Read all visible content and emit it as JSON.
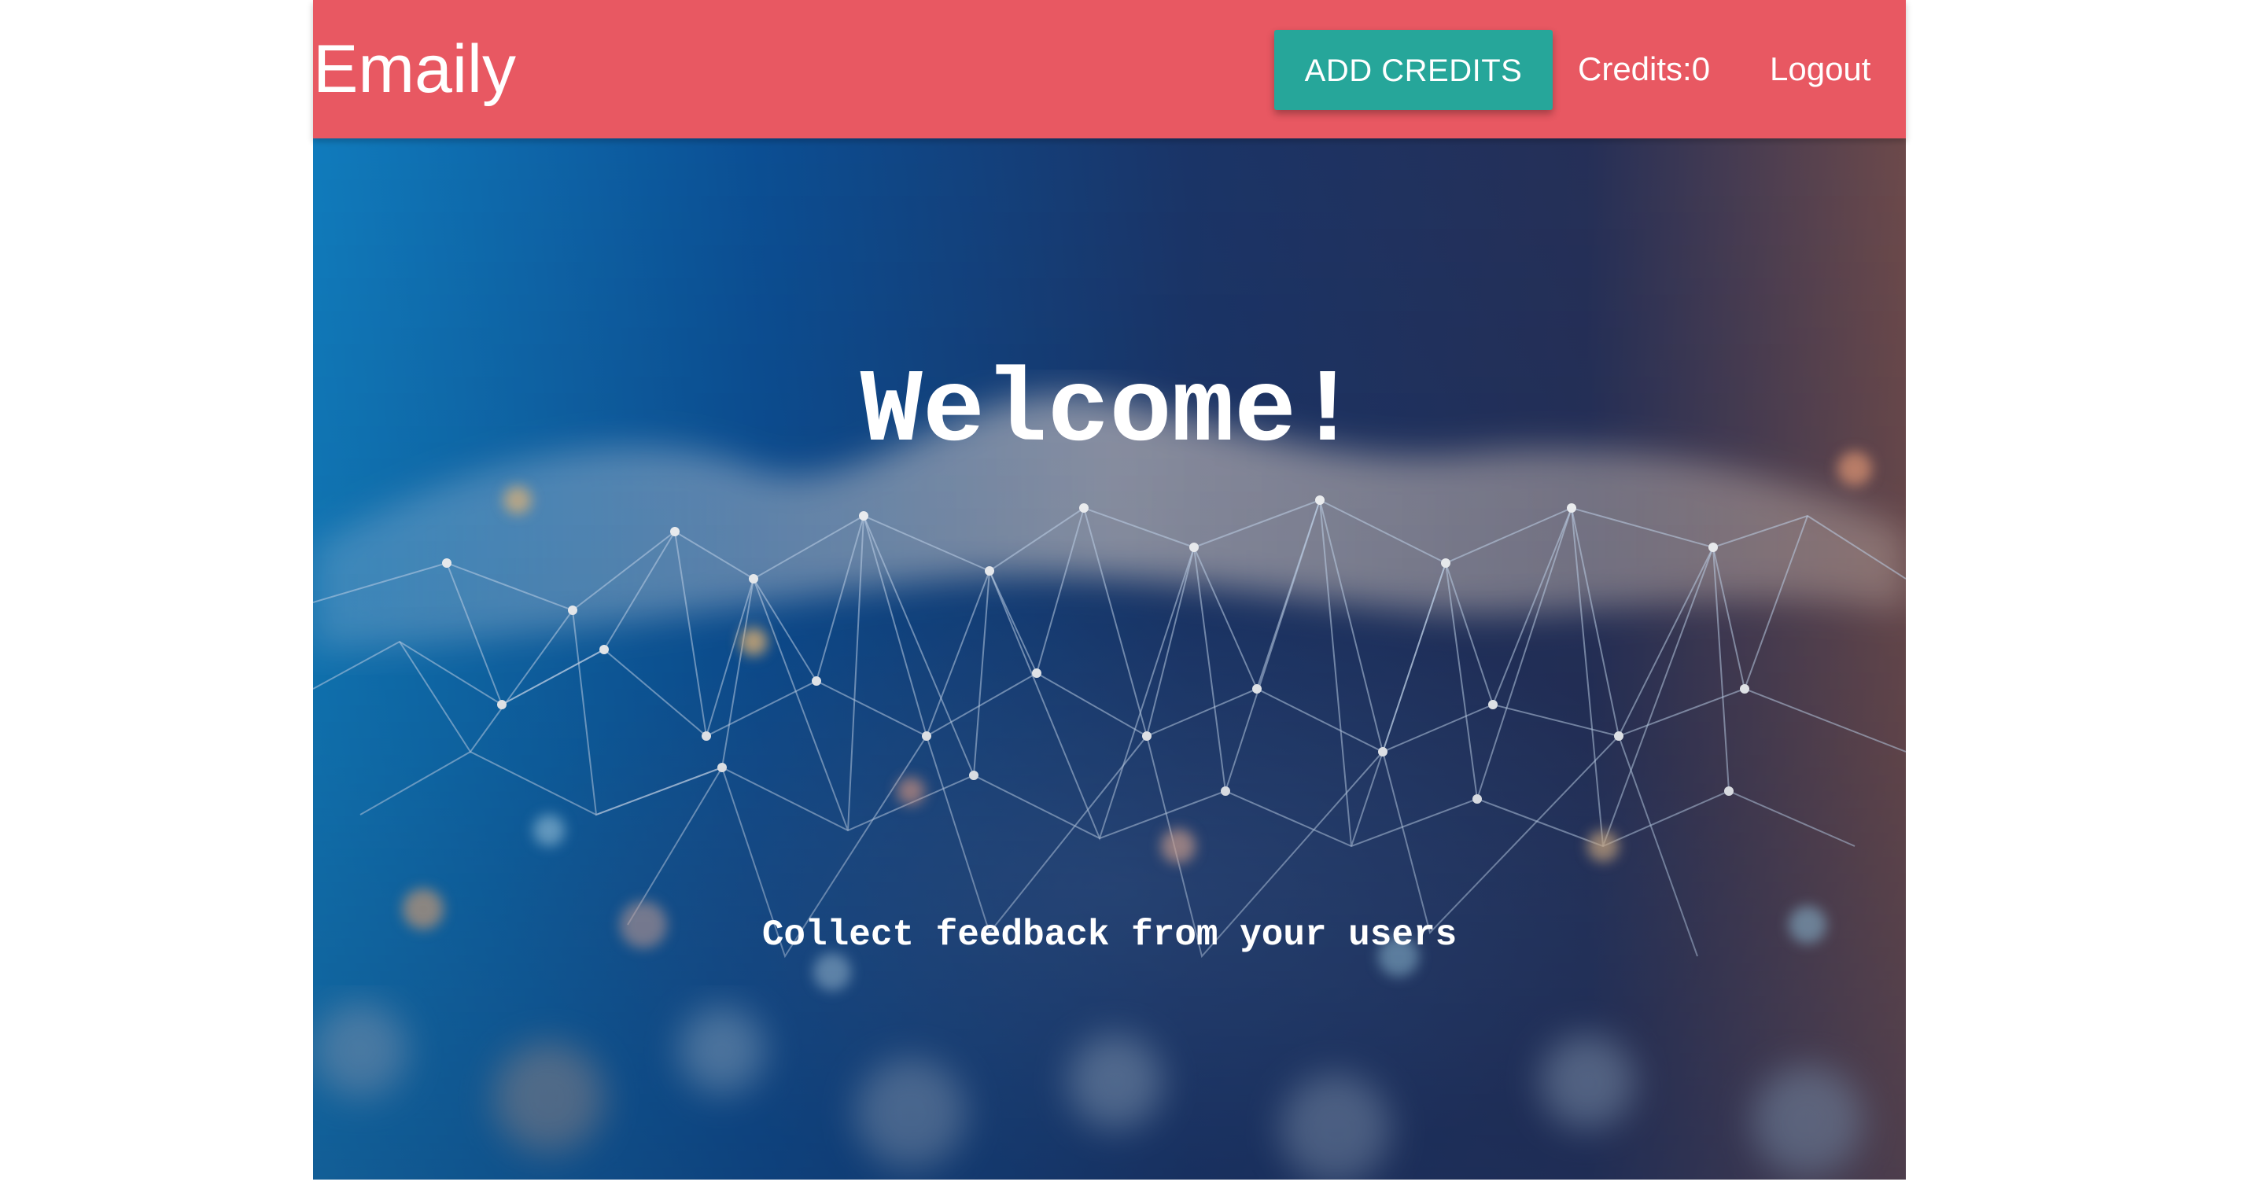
{
  "navbar": {
    "brand": "Emaily",
    "add_credits_label": "ADD CREDITS",
    "credits_text": "Credits:0",
    "logout_label": "Logout",
    "background_color": "#e85862",
    "button_color": "#26a69a"
  },
  "hero": {
    "title": "Welcome!",
    "tagline": "Collect feedback from your users"
  }
}
